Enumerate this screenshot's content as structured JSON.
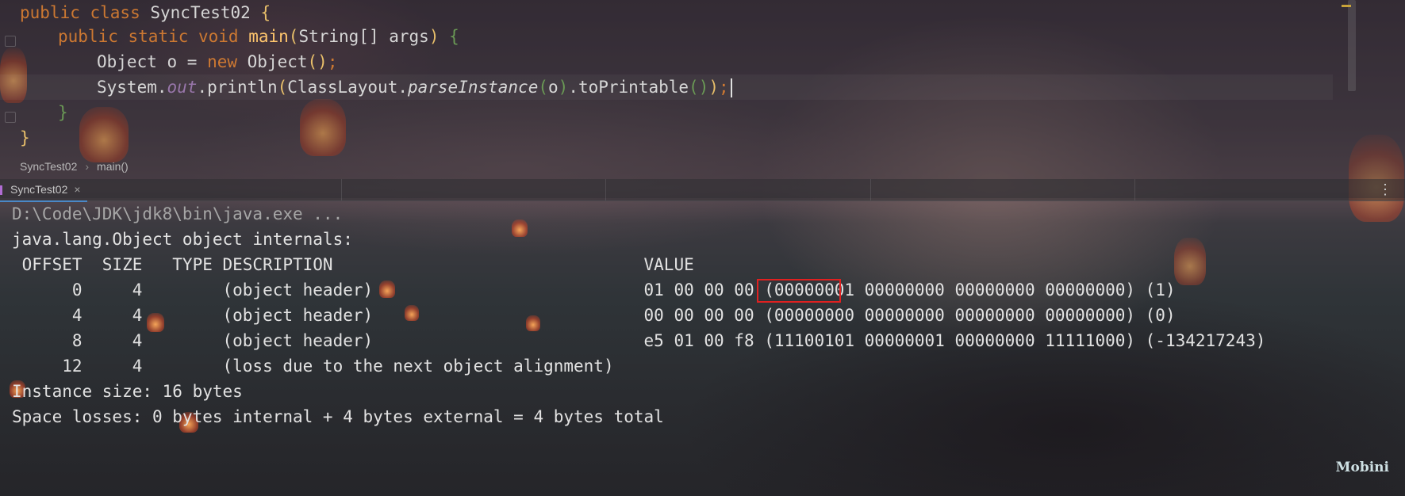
{
  "editor": {
    "code": {
      "line1": {
        "kw": "public class ",
        "name": "SyncTest02 ",
        "brace": "{"
      },
      "line2": {
        "kw": "public static void ",
        "name": "main",
        "open": "(",
        "args": "String[] args",
        "close": ")",
        "brace": " {"
      },
      "line3": {
        "lhs": "Object o = ",
        "kw": "new ",
        "cls": "Object",
        "open": "(",
        "close": ")",
        "semi": ";"
      },
      "line4": {
        "p1": "System.",
        "field": "out",
        "p2": ".println",
        "open1": "(",
        "p3": "ClassLayout.",
        "method": "parseInstance",
        "open2": "(",
        "arg": "o",
        "close2": ")",
        "p4": ".toPrintable",
        "open3": "(",
        "close3": ")",
        "close1": ")",
        "semi": ";"
      },
      "line5": {
        "brace": "}"
      },
      "line6": {
        "brace": "}"
      }
    },
    "breadcrumb": {
      "file": "SyncTest02",
      "method": "main()"
    }
  },
  "run_panel": {
    "tab_label": "SyncTest02",
    "tab_close": "×",
    "more_icon": "⋮",
    "console": {
      "command": "D:\\Code\\JDK\\jdk8\\bin\\java.exe ...",
      "header": "java.lang.Object object internals:",
      "columns": " OFFSET  SIZE   TYPE DESCRIPTION                               VALUE",
      "rows": [
        "      0     4        (object header)                           01 00 00 00 (00000001 00000000 00000000 00000000) (1)",
        "      4     4        (object header)                           00 00 00 00 (00000000 00000000 00000000 00000000) (0)",
        "      8     4        (object header)                           e5 01 00 f8 (11100101 00000001 00000000 11111000) (-134217243)",
        "     12     4        (loss due to the next object alignment)"
      ],
      "instance_size": "Instance size: 16 bytes",
      "space_losses": "Space losses: 0 bytes internal + 4 bytes external = 4 bytes total"
    }
  },
  "watermark": "Mobini",
  "colors": {
    "keyword": "#cc7832",
    "method": "#ffc66d",
    "field": "#9876aa",
    "highlight_box": "#e02020",
    "tab_underline": "#4a88c7"
  }
}
